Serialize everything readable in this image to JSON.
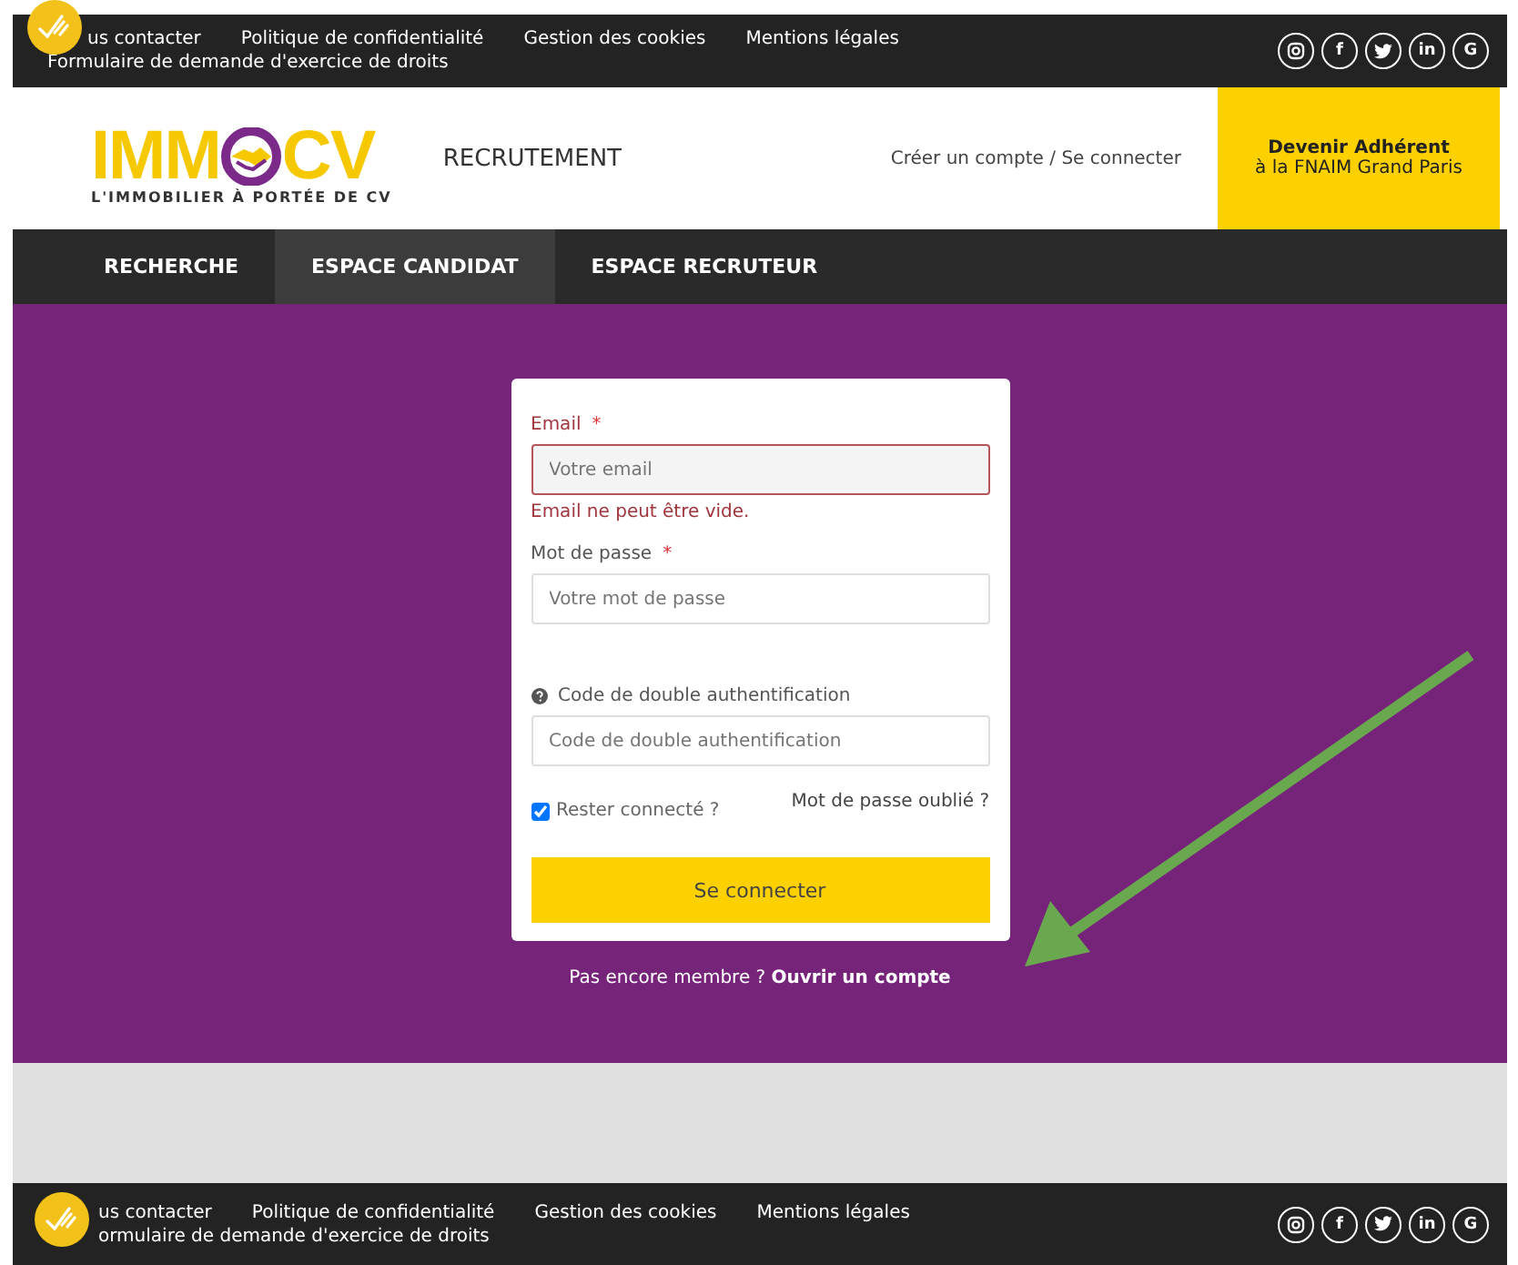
{
  "top_bar": {
    "links": [
      "us contacter",
      "Politique de confidentialité",
      "Gestion des cookies",
      "Mentions légales"
    ],
    "second_line": "Formulaire de demande d'exercice de droits",
    "social": [
      {
        "kind": "instagram"
      },
      {
        "kind": "letter",
        "glyph": "f"
      },
      {
        "kind": "twitter"
      },
      {
        "kind": "letter",
        "glyph": "in"
      },
      {
        "kind": "letter",
        "glyph": "G"
      }
    ]
  },
  "header": {
    "logo": {
      "left": "IMM",
      "right": "CV",
      "tagline": "L'IMMOBILIER À PORTÉE DE CV"
    },
    "section": "RECRUTEMENT",
    "account_link": "Créer un compte / Se connecter",
    "cta": {
      "title": "Devenir Adhérent",
      "subtitle": "à la FNAIM Grand Paris"
    }
  },
  "nav": [
    {
      "label": "RECHERCHE",
      "selected": false
    },
    {
      "label": "ESPACE CANDIDAT",
      "selected": true
    },
    {
      "label": "ESPACE RECRUTEUR",
      "selected": false
    }
  ],
  "form": {
    "fields": [
      {
        "label": "Email",
        "required": true,
        "placeholder": "Votre email",
        "error": "Email ne peut être vide.",
        "help": false
      },
      {
        "label": "Mot de passe",
        "required": true,
        "placeholder": "Votre mot de passe",
        "help": false
      },
      {
        "label": "Code de double authentification",
        "required": false,
        "placeholder": "Code de double authentification",
        "help": true
      }
    ],
    "remember": {
      "label": "Rester connecté ?",
      "checked": true
    },
    "forgot": "Mot de passe oublié ?",
    "submit": "Se connecter",
    "required_mark": "*"
  },
  "signup": {
    "text": "Pas encore membre ? ",
    "link": "Ouvrir un compte"
  },
  "footer": {
    "links": [
      "us contacter",
      "Politique de confidentialité",
      "Gestion des cookies",
      "Mentions légales"
    ],
    "second_line": "ormulaire de demande d'exercice de droits",
    "social": [
      {
        "kind": "instagram"
      },
      {
        "kind": "letter",
        "glyph": "f"
      },
      {
        "kind": "twitter"
      },
      {
        "kind": "letter",
        "glyph": "in"
      },
      {
        "kind": "letter",
        "glyph": "G"
      }
    ]
  }
}
